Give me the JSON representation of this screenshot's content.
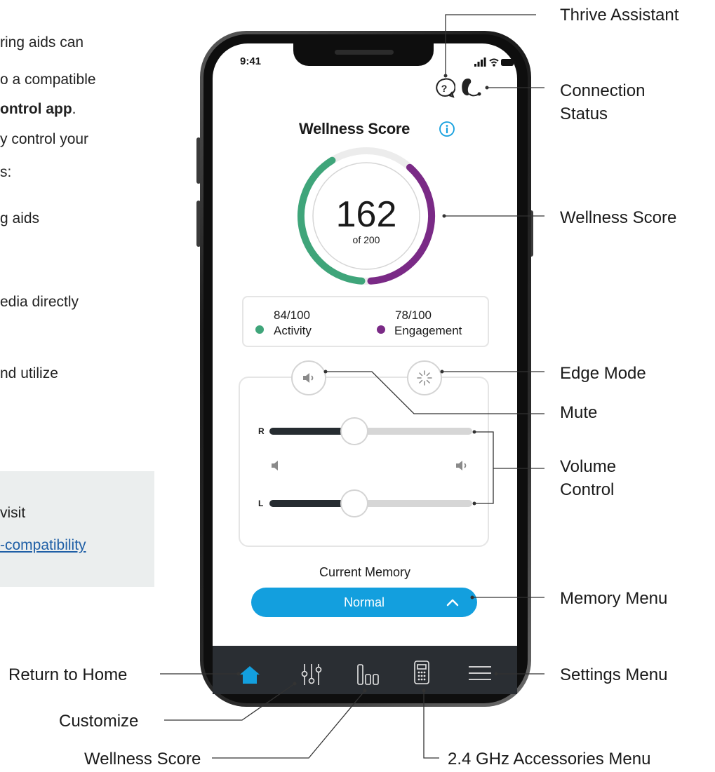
{
  "left_text": {
    "line1": "ring aids can",
    "line2": "o a compatible",
    "line3_bold": "ontrol app",
    "line3_tail": ".",
    "line4": "y control your",
    "line5": "s:",
    "line6": "g aids",
    "line7": "edia directly",
    "line8": "nd utilize",
    "note_line1": "visit",
    "note_link": "-compatibility"
  },
  "status_bar": {
    "time": "9:41"
  },
  "wellness": {
    "title": "Wellness Score",
    "score": "162",
    "of_label": "of 200",
    "score_value": 162,
    "score_max": 200,
    "activity_value": "84/100",
    "activity_label": "Activity",
    "engagement_value": "78/100",
    "engagement_label": "Engagement",
    "activity_color": "#3fa57a",
    "engagement_color": "#7a2a86"
  },
  "volume": {
    "right_label": "R",
    "left_label": "L",
    "right_level": 0.42,
    "left_level": 0.42
  },
  "memory": {
    "label": "Current Memory",
    "selected": "Normal",
    "button_color": "#139fde"
  },
  "nav": {
    "items": [
      "home-icon",
      "sliders-icon",
      "bars-icon",
      "accessory-icon",
      "menu-icon"
    ],
    "active_color": "#139fde"
  },
  "callouts": {
    "thrive_assistant": "Thrive Assistant",
    "connection_status_1": "Connection",
    "connection_status_2": "Status",
    "wellness_score": "Wellness Score",
    "edge_mode": "Edge Mode",
    "mute": "Mute",
    "volume_control_1": "Volume",
    "volume_control_2": "Control",
    "memory_menu": "Memory Menu",
    "settings_menu": "Settings Menu",
    "return_home": "Return to Home",
    "customize": "Customize",
    "wellness_score_nav": "Wellness Score",
    "accessories_menu": "2.4 GHz Accessories Menu"
  }
}
